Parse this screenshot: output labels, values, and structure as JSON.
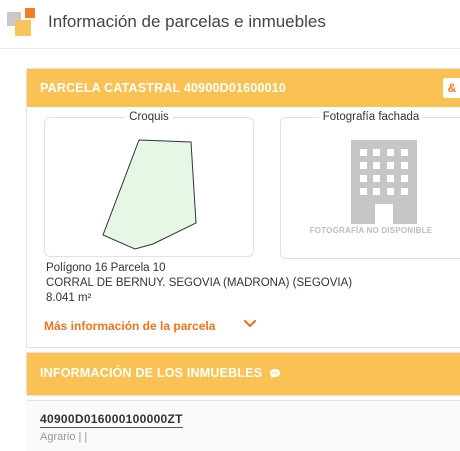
{
  "header": {
    "title": "Información de parcelas e inmuebles"
  },
  "parcela": {
    "header_title": "PARCELA CATASTRAL 40900D01600010",
    "corner_icon": "&",
    "croquis_label": "Croquis",
    "fachada_label": "Fotografía fachada",
    "no_foto": "FOTOGRAFÍA NO DISPONIBLE",
    "poligono": "Polígono 16 Parcela 10",
    "localizacion": "CORRAL DE BERNUY. SEGOVIA (MADRONA) (SEGOVIA)",
    "superficie": "8.041 m²",
    "mas_info": "Más información de la parcela"
  },
  "inmuebles": {
    "header_title": "INFORMACIÓN DE LOS INMUEBLES",
    "items": [
      {
        "ref": "40900D016000100000ZT",
        "uso": "Agrario | |"
      }
    ]
  },
  "colors": {
    "accent": "#f9c253",
    "link": "#e8751f"
  }
}
